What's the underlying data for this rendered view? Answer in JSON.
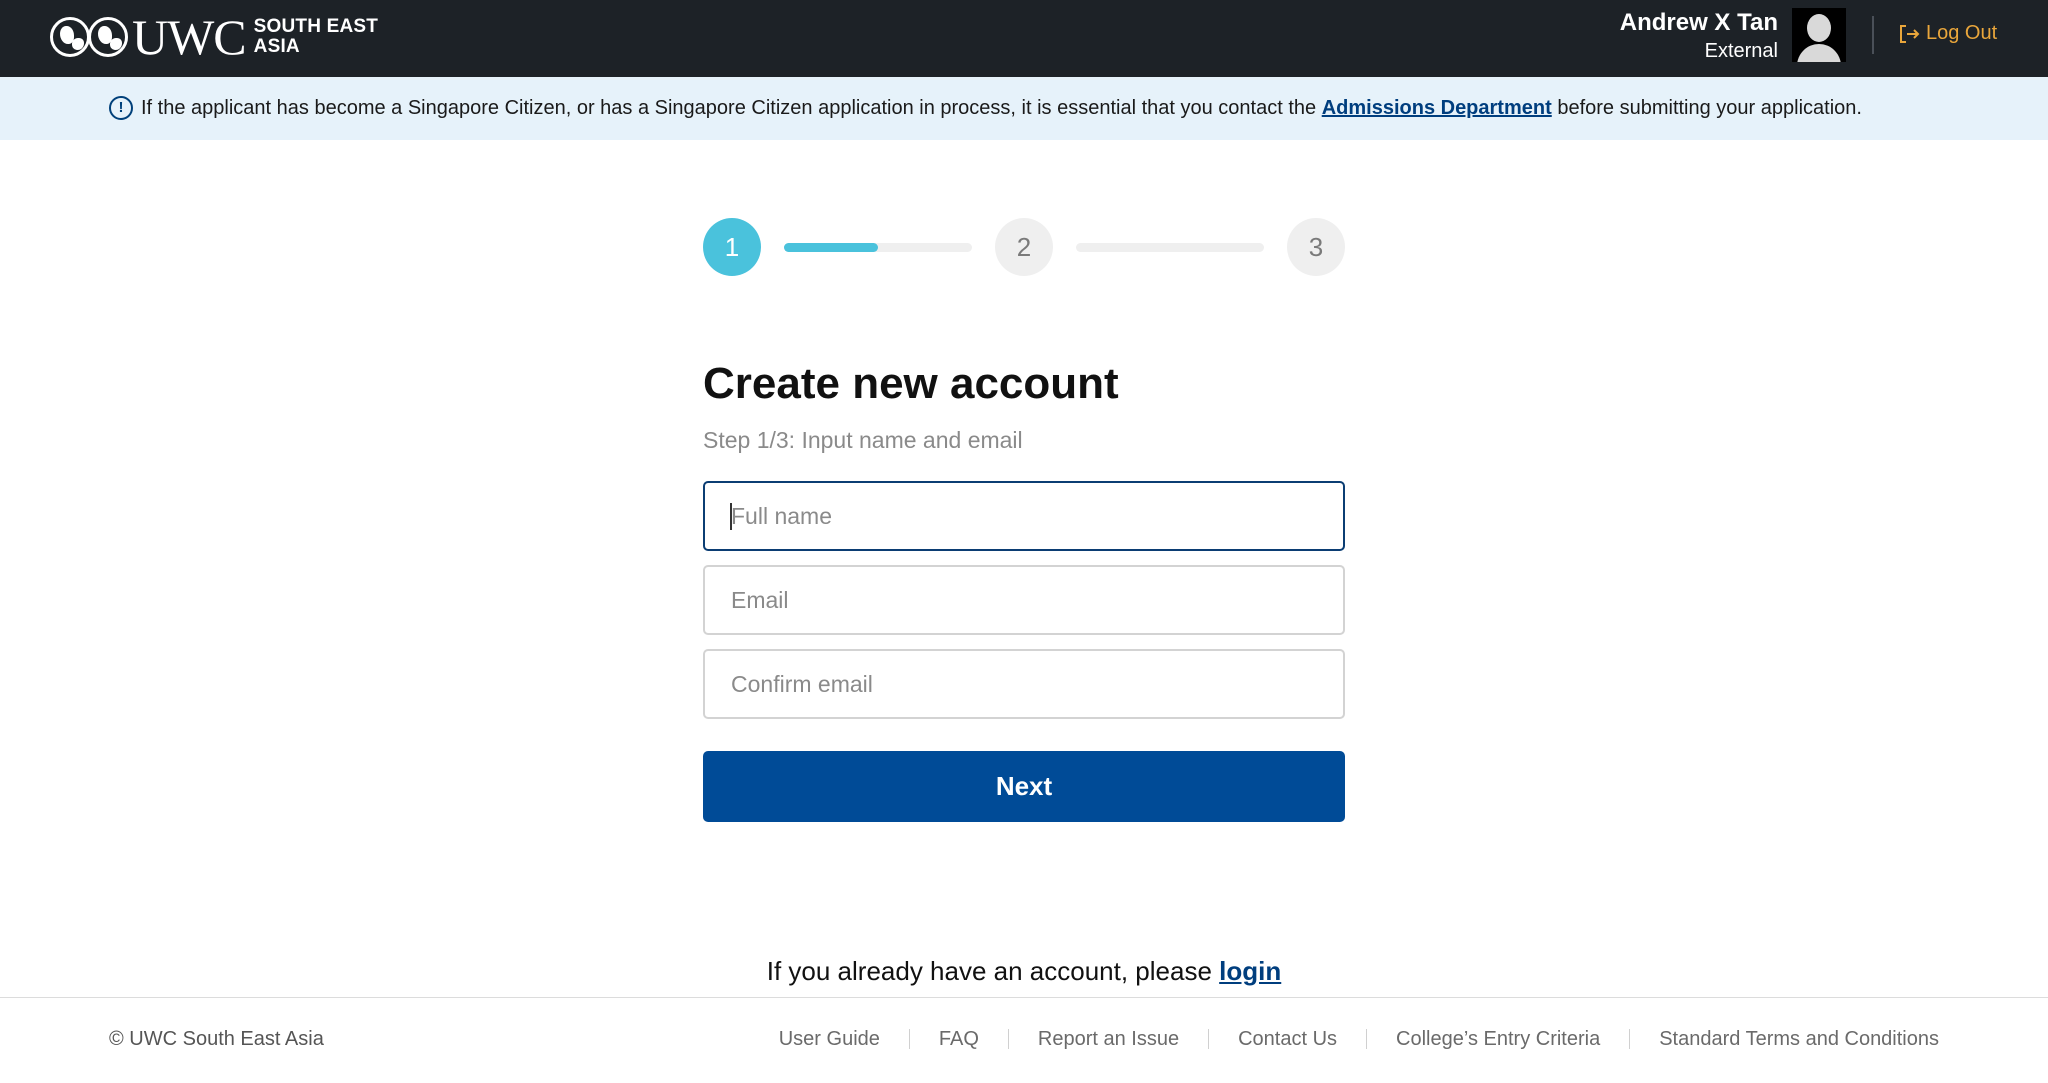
{
  "header": {
    "logo_text": "UWC",
    "logo_subtitle_line1": "SOUTH EAST",
    "logo_subtitle_line2": "ASIA",
    "user_name": "Andrew X Tan",
    "user_role": "External",
    "logout_label": "Log Out",
    "logout_color": "#e9a63b"
  },
  "notice": {
    "text_before": "If the applicant has become a Singapore Citizen, or has a Singapore Citizen application in process, it is essential that you contact the",
    "link_label": "Admissions Department",
    "text_after": "before submitting your application."
  },
  "stepper": {
    "steps": [
      "1",
      "2",
      "3"
    ],
    "current_step": 1,
    "progress_fraction": 0.5,
    "active_color": "#4ac2dc"
  },
  "form": {
    "title": "Create new account",
    "subtitle": "Step 1/3: Input name and email",
    "full_name_placeholder": "Full name",
    "email_placeholder": "Email",
    "confirm_email_placeholder": "Confirm email",
    "next_label": "Next",
    "button_color": "#004b97"
  },
  "login_prompt": {
    "text": "If you already have an account, please",
    "link_label": "login"
  },
  "footer": {
    "copyright": "© UWC South East Asia",
    "links": [
      "User Guide",
      "FAQ",
      "Report an Issue",
      "Contact Us",
      "College’s Entry Criteria",
      "Standard Terms and Conditions"
    ]
  }
}
